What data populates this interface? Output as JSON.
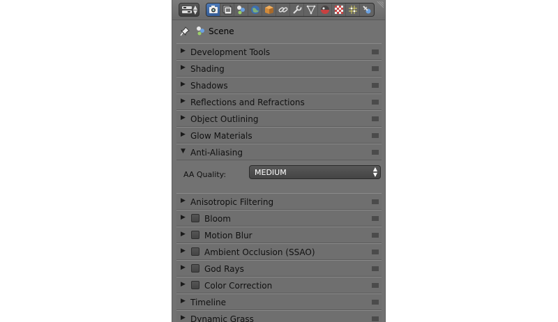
{
  "context": {
    "scene_label": "Scene"
  },
  "panels": [
    {
      "label": "Development Tools",
      "expanded": false,
      "checkbox": false
    },
    {
      "label": "Shading",
      "expanded": false,
      "checkbox": false
    },
    {
      "label": "Shadows",
      "expanded": false,
      "checkbox": false
    },
    {
      "label": "Reflections and Refractions",
      "expanded": false,
      "checkbox": false
    },
    {
      "label": "Object Outlining",
      "expanded": false,
      "checkbox": false
    },
    {
      "label": "Glow Materials",
      "expanded": false,
      "checkbox": false
    },
    {
      "label": "Anti-Aliasing",
      "expanded": true,
      "checkbox": false
    },
    {
      "label": "Anisotropic Filtering",
      "expanded": false,
      "checkbox": false
    },
    {
      "label": "Bloom",
      "expanded": false,
      "checkbox": true,
      "checked": false
    },
    {
      "label": "Motion Blur",
      "expanded": false,
      "checkbox": true,
      "checked": false
    },
    {
      "label": "Ambient Occlusion (SSAO)",
      "expanded": false,
      "checkbox": true,
      "checked": false
    },
    {
      "label": "God Rays",
      "expanded": false,
      "checkbox": true,
      "checked": false
    },
    {
      "label": "Color Correction",
      "expanded": false,
      "checkbox": true,
      "checked": false
    },
    {
      "label": "Timeline",
      "expanded": false,
      "checkbox": false
    },
    {
      "label": "Dynamic Grass",
      "expanded": false,
      "checkbox": false
    }
  ],
  "anti_aliasing": {
    "quality_label": "AA Quality:",
    "quality_value": "MEDIUM"
  },
  "icons": {
    "collapsed": "▶",
    "expanded": "▼",
    "active_tab": "render-icon",
    "tabs": [
      "render-icon",
      "render-layers-icon",
      "scene-icon",
      "world-icon",
      "object-icon",
      "constraints-icon",
      "modifiers-icon",
      "data-icon",
      "material-icon",
      "texture-icon",
      "particles-icon",
      "physics-icon"
    ]
  },
  "colors": {
    "panel_bg": "#727272",
    "active_tab": "#4a76b4",
    "text": "#101010"
  }
}
